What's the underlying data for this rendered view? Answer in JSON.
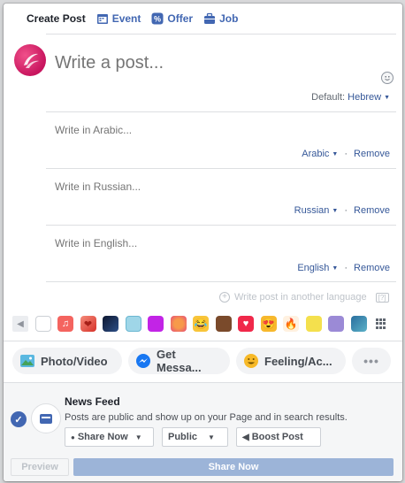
{
  "tabs": [
    {
      "label": "Create Post",
      "icon": "",
      "active": true
    },
    {
      "label": "Event",
      "icon": "calendar-icon",
      "active": false
    },
    {
      "label": "Offer",
      "icon": "offer-tag-icon",
      "active": false
    },
    {
      "label": "Job",
      "icon": "briefcase-icon",
      "active": false
    }
  ],
  "composer": {
    "placeholder": "Write a post...",
    "default_prefix": "Default:",
    "default_lang": "Hebrew"
  },
  "translations": [
    {
      "placeholder": "Write in Arabic...",
      "lang": "Arabic",
      "remove": "Remove"
    },
    {
      "placeholder": "Write in Russian...",
      "lang": "Russian",
      "remove": "Remove"
    },
    {
      "placeholder": "Write in English...",
      "lang": "English",
      "remove": "Remove"
    }
  ],
  "another_language": "Write post in another language",
  "another_help": "[?]",
  "backgrounds": [
    {
      "name": "white",
      "color": "#ffffff"
    },
    {
      "name": "music-notes",
      "color": "#f4645f"
    },
    {
      "name": "hearts",
      "color": "#e9473b"
    },
    {
      "name": "dark-blue-pattern",
      "color": "#1c2a4a"
    },
    {
      "name": "light-blue-pattern",
      "color": "#9fd6e8"
    },
    {
      "name": "purple",
      "color": "#c224e6"
    },
    {
      "name": "orange-pink",
      "color": "#f26a55"
    },
    {
      "name": "laughing-emoji",
      "color": "#f8c53a"
    },
    {
      "name": "brown-emoji",
      "color": "#7a4a2b"
    },
    {
      "name": "red-heart",
      "color": "#f0284a"
    },
    {
      "name": "heart-eyes-emoji",
      "color": "#f7b82d"
    },
    {
      "name": "fire",
      "color": "#f5512a"
    },
    {
      "name": "yellow-figure",
      "color": "#f4e04d"
    },
    {
      "name": "lavender",
      "color": "#9b8ad6"
    },
    {
      "name": "blue-teal",
      "color": "#3d87b8"
    }
  ],
  "actions": [
    {
      "label": "Photo/Video",
      "icon": "photo-icon",
      "color": "#5ab8e0"
    },
    {
      "label": "Get Messa...",
      "icon": "messenger-icon",
      "color": "#1877f2"
    },
    {
      "label": "Feeling/Ac...",
      "icon": "feeling-emoji-icon",
      "color": "#f7b928"
    }
  ],
  "more_label": "•••",
  "footer": {
    "title": "News Feed",
    "description": "Posts are public and show up on your Page and in search results.",
    "share_now": "Share Now",
    "audience": "Public",
    "boost": "Boost Post",
    "preview": "Preview",
    "share_button": "Share Now"
  },
  "colors": {
    "accent": "#4267b2",
    "link": "#365899",
    "share_disabled": "#9cb4d8"
  }
}
